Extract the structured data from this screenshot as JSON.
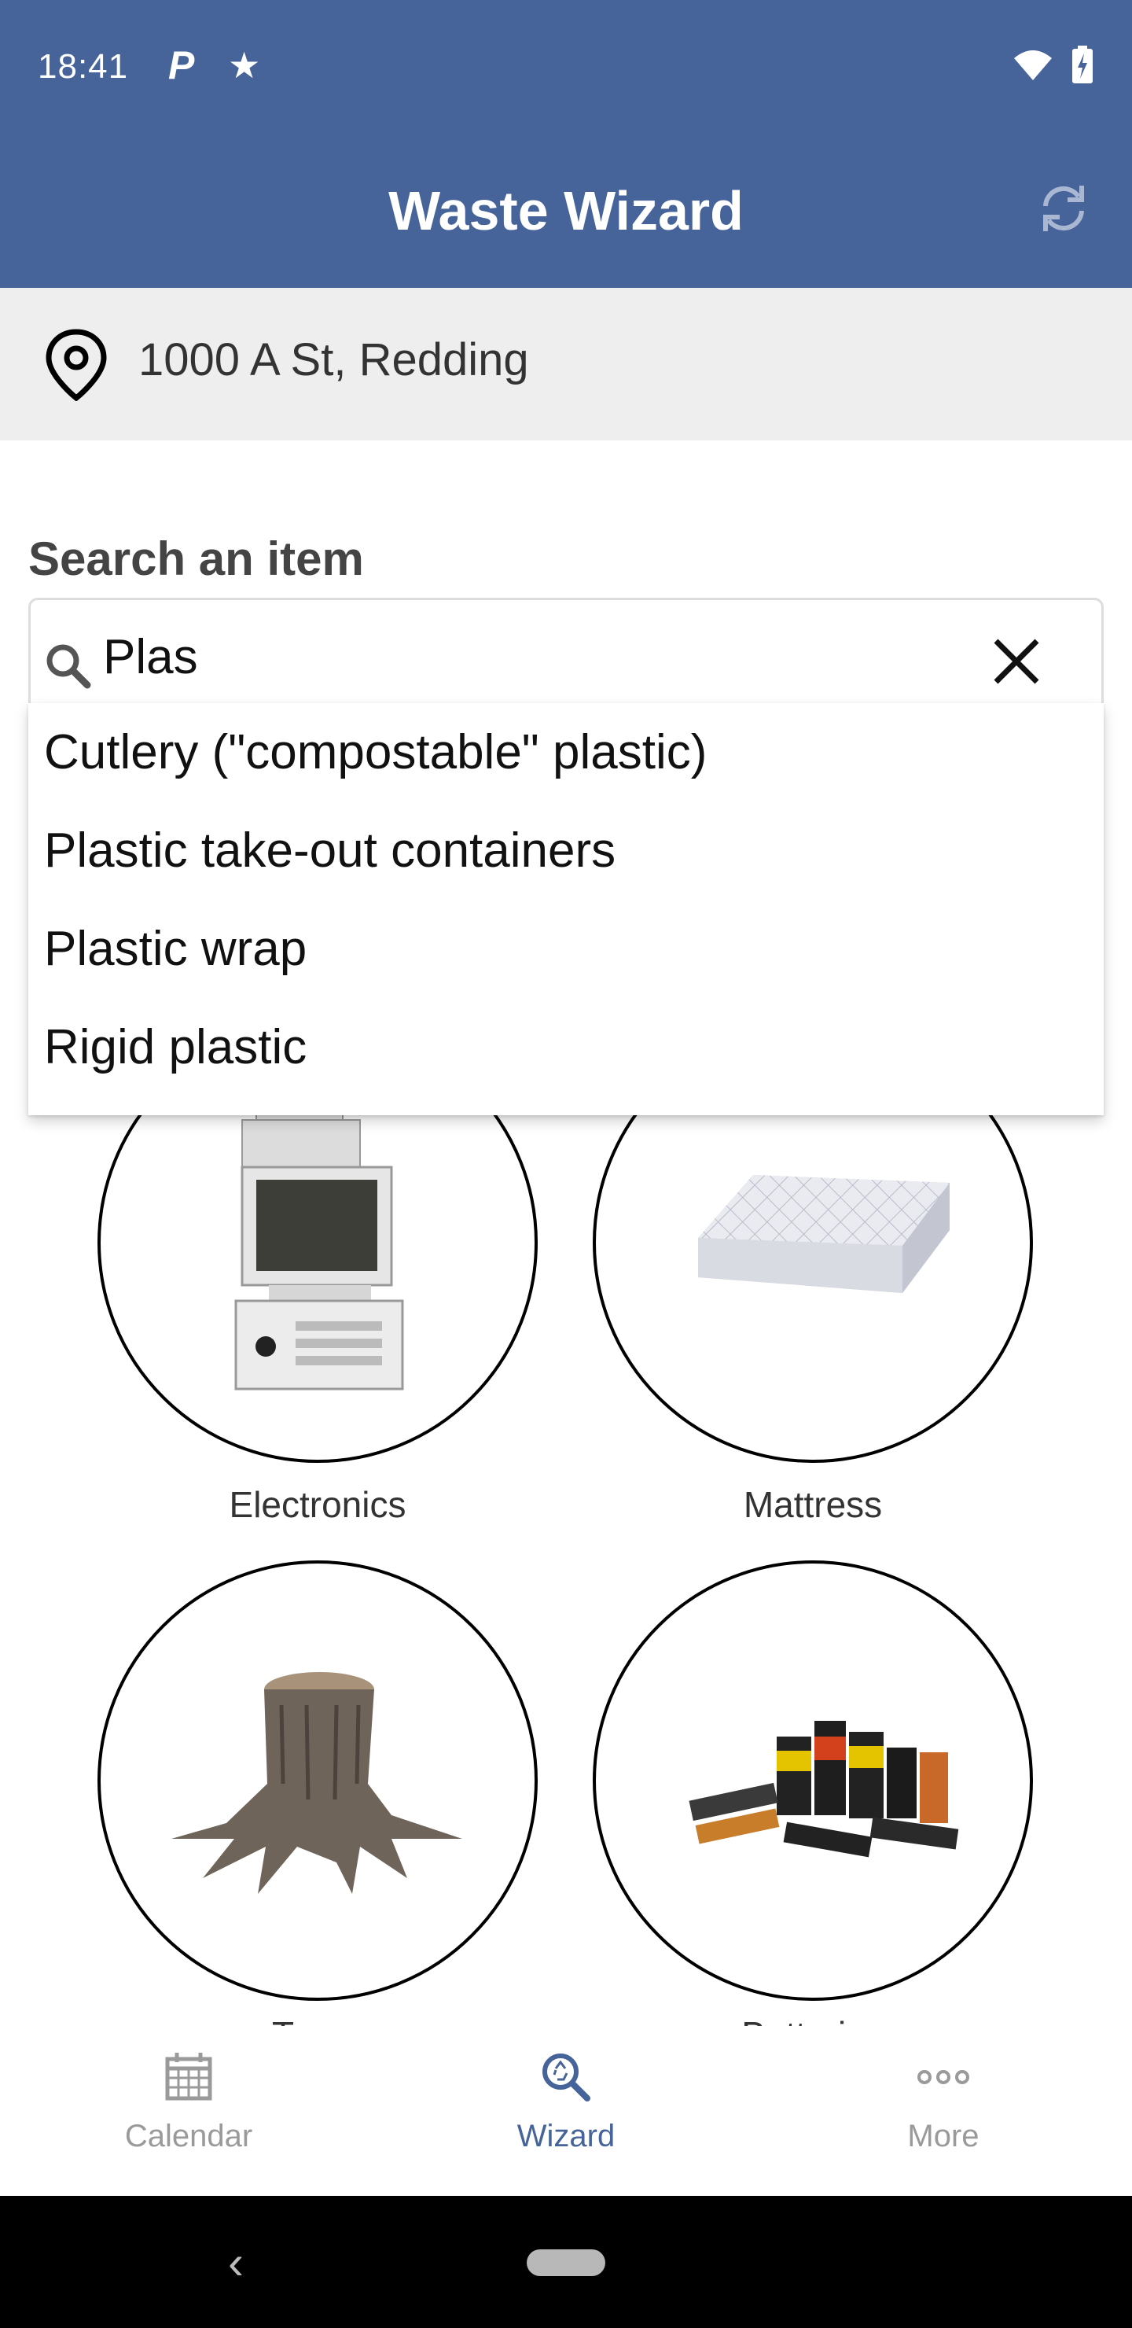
{
  "status_bar": {
    "time": "18:41",
    "p_icon": "P",
    "icons": [
      "parking-icon",
      "star-icon",
      "wifi-icon",
      "battery-charging-icon"
    ]
  },
  "app_bar": {
    "title": "Waste Wizard",
    "refresh_icon": "refresh-icon"
  },
  "location": {
    "address": "1000 A St, Redding",
    "icon": "location-pin-icon"
  },
  "search": {
    "label": "Search an item",
    "value": "Plas",
    "icon": "search-icon",
    "clear_icon": "close-icon"
  },
  "suggestions": [
    "Cutlery (\"compostable\" plastic)",
    "Plastic take-out containers",
    "Plastic wrap",
    "Rigid plastic"
  ],
  "categories": [
    {
      "label": "Electronics",
      "image": "computer-image"
    },
    {
      "label": "Mattress",
      "image": "mattress-image"
    },
    {
      "label": "Trees",
      "image": "tree-stump-image"
    },
    {
      "label": "Batteries",
      "image": "batteries-image"
    }
  ],
  "bottom_nav": {
    "items": [
      {
        "label": "Calendar",
        "icon": "calendar-icon",
        "active": false
      },
      {
        "label": "Wizard",
        "icon": "wizard-search-icon",
        "active": true
      },
      {
        "label": "More",
        "icon": "more-icon",
        "active": false
      }
    ]
  },
  "colors": {
    "primary": "#46639a",
    "location_bg": "#eeeeee",
    "inactive": "#9a9a9a"
  }
}
